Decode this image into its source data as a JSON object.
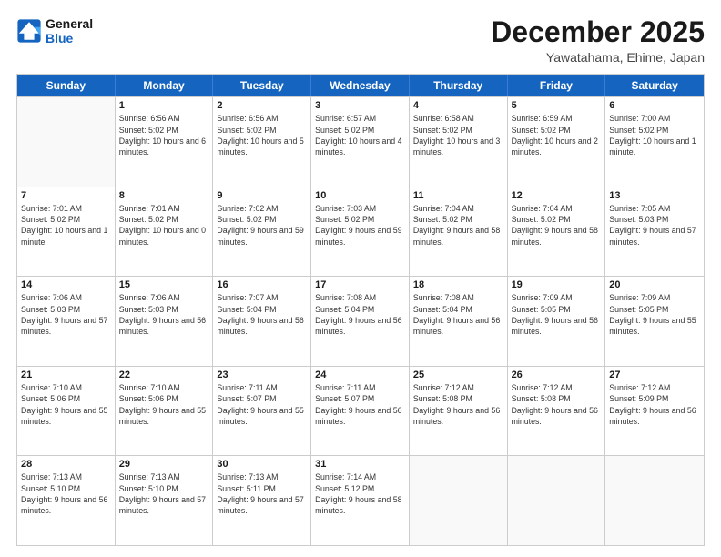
{
  "logo": {
    "line1": "General",
    "line2": "Blue"
  },
  "title": "December 2025",
  "location": "Yawatahama, Ehime, Japan",
  "days_of_week": [
    "Sunday",
    "Monday",
    "Tuesday",
    "Wednesday",
    "Thursday",
    "Friday",
    "Saturday"
  ],
  "weeks": [
    [
      {
        "day": null
      },
      {
        "day": "1",
        "sunrise": "6:56 AM",
        "sunset": "5:02 PM",
        "daylight": "10 hours and 6 minutes."
      },
      {
        "day": "2",
        "sunrise": "6:56 AM",
        "sunset": "5:02 PM",
        "daylight": "10 hours and 5 minutes."
      },
      {
        "day": "3",
        "sunrise": "6:57 AM",
        "sunset": "5:02 PM",
        "daylight": "10 hours and 4 minutes."
      },
      {
        "day": "4",
        "sunrise": "6:58 AM",
        "sunset": "5:02 PM",
        "daylight": "10 hours and 3 minutes."
      },
      {
        "day": "5",
        "sunrise": "6:59 AM",
        "sunset": "5:02 PM",
        "daylight": "10 hours and 2 minutes."
      },
      {
        "day": "6",
        "sunrise": "7:00 AM",
        "sunset": "5:02 PM",
        "daylight": "10 hours and 1 minute."
      }
    ],
    [
      {
        "day": "7",
        "sunrise": "7:01 AM",
        "sunset": "5:02 PM",
        "daylight": "10 hours and 1 minute."
      },
      {
        "day": "8",
        "sunrise": "7:01 AM",
        "sunset": "5:02 PM",
        "daylight": "10 hours and 0 minutes."
      },
      {
        "day": "9",
        "sunrise": "7:02 AM",
        "sunset": "5:02 PM",
        "daylight": "9 hours and 59 minutes."
      },
      {
        "day": "10",
        "sunrise": "7:03 AM",
        "sunset": "5:02 PM",
        "daylight": "9 hours and 59 minutes."
      },
      {
        "day": "11",
        "sunrise": "7:04 AM",
        "sunset": "5:02 PM",
        "daylight": "9 hours and 58 minutes."
      },
      {
        "day": "12",
        "sunrise": "7:04 AM",
        "sunset": "5:02 PM",
        "daylight": "9 hours and 58 minutes."
      },
      {
        "day": "13",
        "sunrise": "7:05 AM",
        "sunset": "5:03 PM",
        "daylight": "9 hours and 57 minutes."
      }
    ],
    [
      {
        "day": "14",
        "sunrise": "7:06 AM",
        "sunset": "5:03 PM",
        "daylight": "9 hours and 57 minutes."
      },
      {
        "day": "15",
        "sunrise": "7:06 AM",
        "sunset": "5:03 PM",
        "daylight": "9 hours and 56 minutes."
      },
      {
        "day": "16",
        "sunrise": "7:07 AM",
        "sunset": "5:04 PM",
        "daylight": "9 hours and 56 minutes."
      },
      {
        "day": "17",
        "sunrise": "7:08 AM",
        "sunset": "5:04 PM",
        "daylight": "9 hours and 56 minutes."
      },
      {
        "day": "18",
        "sunrise": "7:08 AM",
        "sunset": "5:04 PM",
        "daylight": "9 hours and 56 minutes."
      },
      {
        "day": "19",
        "sunrise": "7:09 AM",
        "sunset": "5:05 PM",
        "daylight": "9 hours and 56 minutes."
      },
      {
        "day": "20",
        "sunrise": "7:09 AM",
        "sunset": "5:05 PM",
        "daylight": "9 hours and 55 minutes."
      }
    ],
    [
      {
        "day": "21",
        "sunrise": "7:10 AM",
        "sunset": "5:06 PM",
        "daylight": "9 hours and 55 minutes."
      },
      {
        "day": "22",
        "sunrise": "7:10 AM",
        "sunset": "5:06 PM",
        "daylight": "9 hours and 55 minutes."
      },
      {
        "day": "23",
        "sunrise": "7:11 AM",
        "sunset": "5:07 PM",
        "daylight": "9 hours and 55 minutes."
      },
      {
        "day": "24",
        "sunrise": "7:11 AM",
        "sunset": "5:07 PM",
        "daylight": "9 hours and 56 minutes."
      },
      {
        "day": "25",
        "sunrise": "7:12 AM",
        "sunset": "5:08 PM",
        "daylight": "9 hours and 56 minutes."
      },
      {
        "day": "26",
        "sunrise": "7:12 AM",
        "sunset": "5:08 PM",
        "daylight": "9 hours and 56 minutes."
      },
      {
        "day": "27",
        "sunrise": "7:12 AM",
        "sunset": "5:09 PM",
        "daylight": "9 hours and 56 minutes."
      }
    ],
    [
      {
        "day": "28",
        "sunrise": "7:13 AM",
        "sunset": "5:10 PM",
        "daylight": "9 hours and 56 minutes."
      },
      {
        "day": "29",
        "sunrise": "7:13 AM",
        "sunset": "5:10 PM",
        "daylight": "9 hours and 57 minutes."
      },
      {
        "day": "30",
        "sunrise": "7:13 AM",
        "sunset": "5:11 PM",
        "daylight": "9 hours and 57 minutes."
      },
      {
        "day": "31",
        "sunrise": "7:14 AM",
        "sunset": "5:12 PM",
        "daylight": "9 hours and 58 minutes."
      },
      {
        "day": null
      },
      {
        "day": null
      },
      {
        "day": null
      }
    ]
  ]
}
